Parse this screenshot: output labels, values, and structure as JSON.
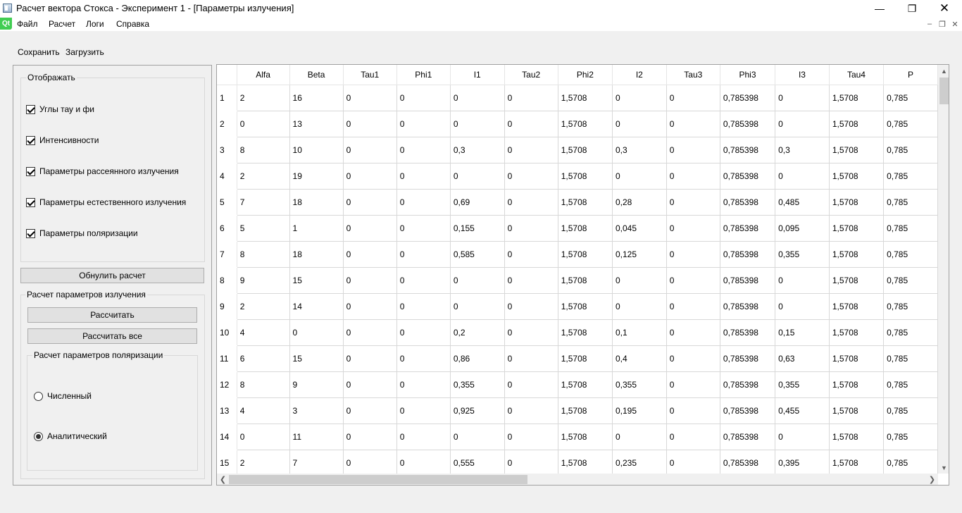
{
  "window": {
    "title": "Расчет вектора Стокса - Эксперимент 1 - [Параметры излучения]",
    "minimize_glyph": "—",
    "maximize_glyph": "❐",
    "close_glyph": "✕"
  },
  "menubar": {
    "logo": "Qt",
    "items": [
      "Файл",
      "Расчет",
      "Логи",
      "Справка"
    ],
    "mdi_minimize": "–",
    "mdi_restore": "❐",
    "mdi_close": "✕"
  },
  "toolbar": {
    "save_label": "Сохранить",
    "load_label": "Загрузить"
  },
  "display_group": {
    "title": "Отображать",
    "checkboxes": [
      {
        "label": "Углы тау и фи",
        "checked": true
      },
      {
        "label": "Интенсивности",
        "checked": true
      },
      {
        "label": "Параметры рассеянного излучения",
        "checked": true
      },
      {
        "label": "Параметры естественного излучения",
        "checked": true
      },
      {
        "label": "Параметры поляризации",
        "checked": true
      }
    ]
  },
  "reset_button": "Обнулить расчет",
  "calc_group": {
    "title": "Расчет параметров излучения",
    "calc_button": "Рассчитать",
    "calc_all_button": "Рассчитать все",
    "polarization_group": {
      "title": "Расчет параметров поляризации",
      "options": [
        {
          "label": "Численный",
          "checked": false
        },
        {
          "label": "Аналитический",
          "checked": true
        }
      ]
    }
  },
  "table": {
    "columns": [
      "Alfa",
      "Beta",
      "Tau1",
      "Phi1",
      "I1",
      "Tau2",
      "Phi2",
      "I2",
      "Tau3",
      "Phi3",
      "I3",
      "Tau4",
      "P"
    ],
    "rows": [
      [
        "2",
        "16",
        "0",
        "0",
        "0",
        "0",
        "1,5708",
        "0",
        "0",
        "0,785398",
        "0",
        "1,5708",
        "0,785"
      ],
      [
        "0",
        "13",
        "0",
        "0",
        "0",
        "0",
        "1,5708",
        "0",
        "0",
        "0,785398",
        "0",
        "1,5708",
        "0,785"
      ],
      [
        "8",
        "10",
        "0",
        "0",
        "0,3",
        "0",
        "1,5708",
        "0,3",
        "0",
        "0,785398",
        "0,3",
        "1,5708",
        "0,785"
      ],
      [
        "2",
        "19",
        "0",
        "0",
        "0",
        "0",
        "1,5708",
        "0",
        "0",
        "0,785398",
        "0",
        "1,5708",
        "0,785"
      ],
      [
        "7",
        "18",
        "0",
        "0",
        "0,69",
        "0",
        "1,5708",
        "0,28",
        "0",
        "0,785398",
        "0,485",
        "1,5708",
        "0,785"
      ],
      [
        "5",
        "1",
        "0",
        "0",
        "0,155",
        "0",
        "1,5708",
        "0,045",
        "0",
        "0,785398",
        "0,095",
        "1,5708",
        "0,785"
      ],
      [
        "8",
        "18",
        "0",
        "0",
        "0,585",
        "0",
        "1,5708",
        "0,125",
        "0",
        "0,785398",
        "0,355",
        "1,5708",
        "0,785"
      ],
      [
        "9",
        "15",
        "0",
        "0",
        "0",
        "0",
        "1,5708",
        "0",
        "0",
        "0,785398",
        "0",
        "1,5708",
        "0,785"
      ],
      [
        "2",
        "14",
        "0",
        "0",
        "0",
        "0",
        "1,5708",
        "0",
        "0",
        "0,785398",
        "0",
        "1,5708",
        "0,785"
      ],
      [
        "4",
        "0",
        "0",
        "0",
        "0,2",
        "0",
        "1,5708",
        "0,1",
        "0",
        "0,785398",
        "0,15",
        "1,5708",
        "0,785"
      ],
      [
        "6",
        "15",
        "0",
        "0",
        "0,86",
        "0",
        "1,5708",
        "0,4",
        "0",
        "0,785398",
        "0,63",
        "1,5708",
        "0,785"
      ],
      [
        "8",
        "9",
        "0",
        "0",
        "0,355",
        "0",
        "1,5708",
        "0,355",
        "0",
        "0,785398",
        "0,355",
        "1,5708",
        "0,785"
      ],
      [
        "4",
        "3",
        "0",
        "0",
        "0,925",
        "0",
        "1,5708",
        "0,195",
        "0",
        "0,785398",
        "0,455",
        "1,5708",
        "0,785"
      ],
      [
        "0",
        "11",
        "0",
        "0",
        "0",
        "0",
        "1,5708",
        "0",
        "0",
        "0,785398",
        "0",
        "1,5708",
        "0,785"
      ],
      [
        "2",
        "7",
        "0",
        "0",
        "0,555",
        "0",
        "1,5708",
        "0,235",
        "0",
        "0,785398",
        "0,395",
        "1,5708",
        "0,785"
      ]
    ]
  },
  "scrollbars": {
    "up": "▲",
    "down": "▼",
    "left": "❮",
    "right": "❯"
  }
}
